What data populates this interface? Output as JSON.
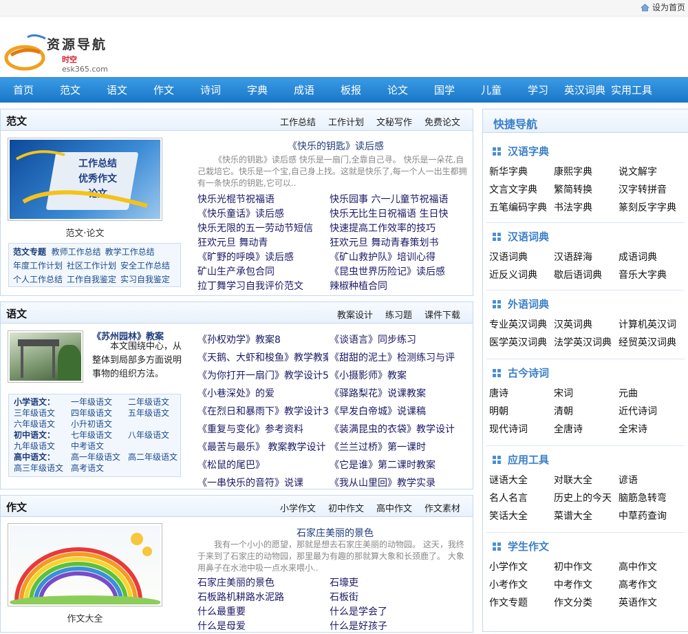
{
  "topbar": {
    "sethome": "设为首页"
  },
  "logo": {
    "title": "资源导航",
    "sub_red": "时空",
    "sub": "esk365.com"
  },
  "nav": [
    "首页",
    "范文",
    "语文",
    "作文",
    "诗词",
    "字典",
    "成语",
    "板报",
    "论文",
    "国学",
    "儿童",
    "学习",
    "英汉词典",
    "实用工具"
  ],
  "fanwen": {
    "title": "范文",
    "links": [
      "工作总结",
      "工作计划",
      "文秘写作",
      "免费论文"
    ],
    "image_lines": [
      "工作总结",
      "优秀作文",
      "论文"
    ],
    "caption": "范文·论文",
    "feature_title": "《快乐的钥匙》读后感",
    "feature_text": "《快乐的钥匙》读后感 快乐是一扇门,全靠自己寻。 快乐是一朵花,自己栽培它。快乐是一个宝,自己身上找。这就是快乐了,每一个人一出生都拥有一条快乐的钥匙,它可以..",
    "list_left": [
      "快乐光棍节祝福语",
      "《快乐童话》读后感",
      "快乐无限的五一劳动节短信",
      "狂欢元旦 舞动青",
      "《旷野的呼唤》读后感",
      "矿山生产承包合同",
      "拉丁舞学习自我评价范文"
    ],
    "list_right": [
      "快乐园事 六一儿童节祝福语",
      "快乐无比生日祝福语 生日快",
      "快速提高工作效率的技巧",
      "狂欢元旦 舞动青春策划书",
      "《矿山救护队》培训心得",
      "《昆虫世界历险记》读后感",
      "辣椒种植合同"
    ],
    "cats": [
      [
        "范文专题",
        "教师工作总结",
        "教学工作总结"
      ],
      [
        "年度工作计划",
        "社区工作计划",
        "安全工作总结"
      ],
      [
        "个人工作总结",
        "工作自我鉴定",
        "实习自我鉴定"
      ]
    ]
  },
  "yuwen": {
    "title": "语文",
    "links": [
      "教案设计",
      "练习题",
      "课件下载"
    ],
    "feature_title": "《苏州园林》教案",
    "feature_text": "本文围绕中心，从整体到局部多方面说明事物的组织方法。",
    "list_left": [
      "《孙权劝学》教案8",
      "《天鹅、大虾和梭鱼》教学教案",
      "《为你打开一扇门》教学设计5",
      "《小巷深处》的爱",
      "《在烈日和暴雨下》教学设计3",
      "《重复与变化》参考资料",
      "《最苦与最乐》 教案教学设计",
      "《松鼠的尾巴》",
      "《一串快乐的音符》说课"
    ],
    "list_right": [
      "《谈语言》同步练习",
      "《甜甜的泥土》检测练习与评",
      "《小摄影师》教案",
      "《驿路梨花》说课教案",
      "《早发白帝城》说课稿",
      "《装满昆虫的衣袋》教学设计",
      "《兰兰过桥》第一课时",
      "《它是谁》第二课时教案",
      "《我从山里回》教学实录"
    ],
    "grid": [
      [
        "小学语文：",
        "一年级语文",
        "二年级语文"
      ],
      [
        "三年级语文",
        "四年级语文",
        "五年级语文"
      ],
      [
        "六年级语文",
        "小升初语文",
        ""
      ],
      [
        "初中语文：",
        "七年级语文",
        "八年级语文"
      ],
      [
        "九年级语文",
        "中考语文",
        ""
      ],
      [
        "高中语文：",
        "高一年级语文",
        "高二年级语文"
      ],
      [
        "高三年级语文",
        "高考语文",
        ""
      ]
    ]
  },
  "zuowen": {
    "title": "作文",
    "links": [
      "小学作文",
      "初中作文",
      "高中作文",
      "作文素材"
    ],
    "caption": "作文大全",
    "feature_title": "石家庄美丽的景色",
    "feature_text": "我有一个小小的愿望，那就是想去石家庄美丽的动物园。 这天，我终于来到了石家庄的动物园，那里最为有趣的那就算大象和长颈鹿了。 大象用鼻子在水池中吸一点水来喂小..",
    "list_left": [
      "石家庄美丽的景色",
      "石板路机耕路水泥路",
      "什么最重要",
      "什么是母爱"
    ],
    "list_right": [
      "石壕吏",
      "石板街",
      "什么是学会了",
      "什么是好孩子"
    ]
  },
  "quicknav": {
    "title": "快捷导航",
    "sections": [
      {
        "title": "汉语字典",
        "rows": [
          [
            "新华字典",
            "康熙字典",
            "说文解字"
          ],
          [
            "文言文字典",
            "繁简转换",
            "汉字转拼音"
          ],
          [
            "五笔编码字典",
            "书法字典",
            "篆刻反字字典"
          ]
        ]
      },
      {
        "title": "汉语词典",
        "rows": [
          [
            "汉语词典",
            "汉语辞海",
            "成语词典"
          ],
          [
            "近反义词典",
            "歇后语词典",
            "音乐大字典"
          ]
        ]
      },
      {
        "title": "外语词典",
        "rows": [
          [
            "专业英汉词典",
            "汉英词典",
            "计算机英汉词"
          ],
          [
            "医学英汉词典",
            "法学英汉词典",
            "经贸英汉词典"
          ]
        ]
      },
      {
        "title": "古今诗词",
        "rows": [
          [
            "唐诗",
            "宋词",
            "元曲"
          ],
          [
            "明朝",
            "清朝",
            "近代诗词"
          ],
          [
            "现代诗词",
            "全唐诗",
            "全宋诗"
          ]
        ]
      },
      {
        "title": "应用工具",
        "rows": [
          [
            "谜语大全",
            "对联大全",
            "谚语"
          ],
          [
            "名人名言",
            "历史上的今天",
            "脑筋急转弯"
          ],
          [
            "笑话大全",
            "菜谱大全",
            "中草药查询"
          ]
        ]
      },
      {
        "title": "学生作文",
        "rows": [
          [
            "小学作文",
            "初中作文",
            "高中作文"
          ],
          [
            "小考作文",
            "中考作文",
            "高考作文"
          ],
          [
            "作文专题",
            "作文分类",
            "英语作文"
          ]
        ]
      }
    ]
  },
  "colors": {
    "nav": "#1f7fd0",
    "accent": "#3a7fc9",
    "link": "#1a1a66"
  }
}
